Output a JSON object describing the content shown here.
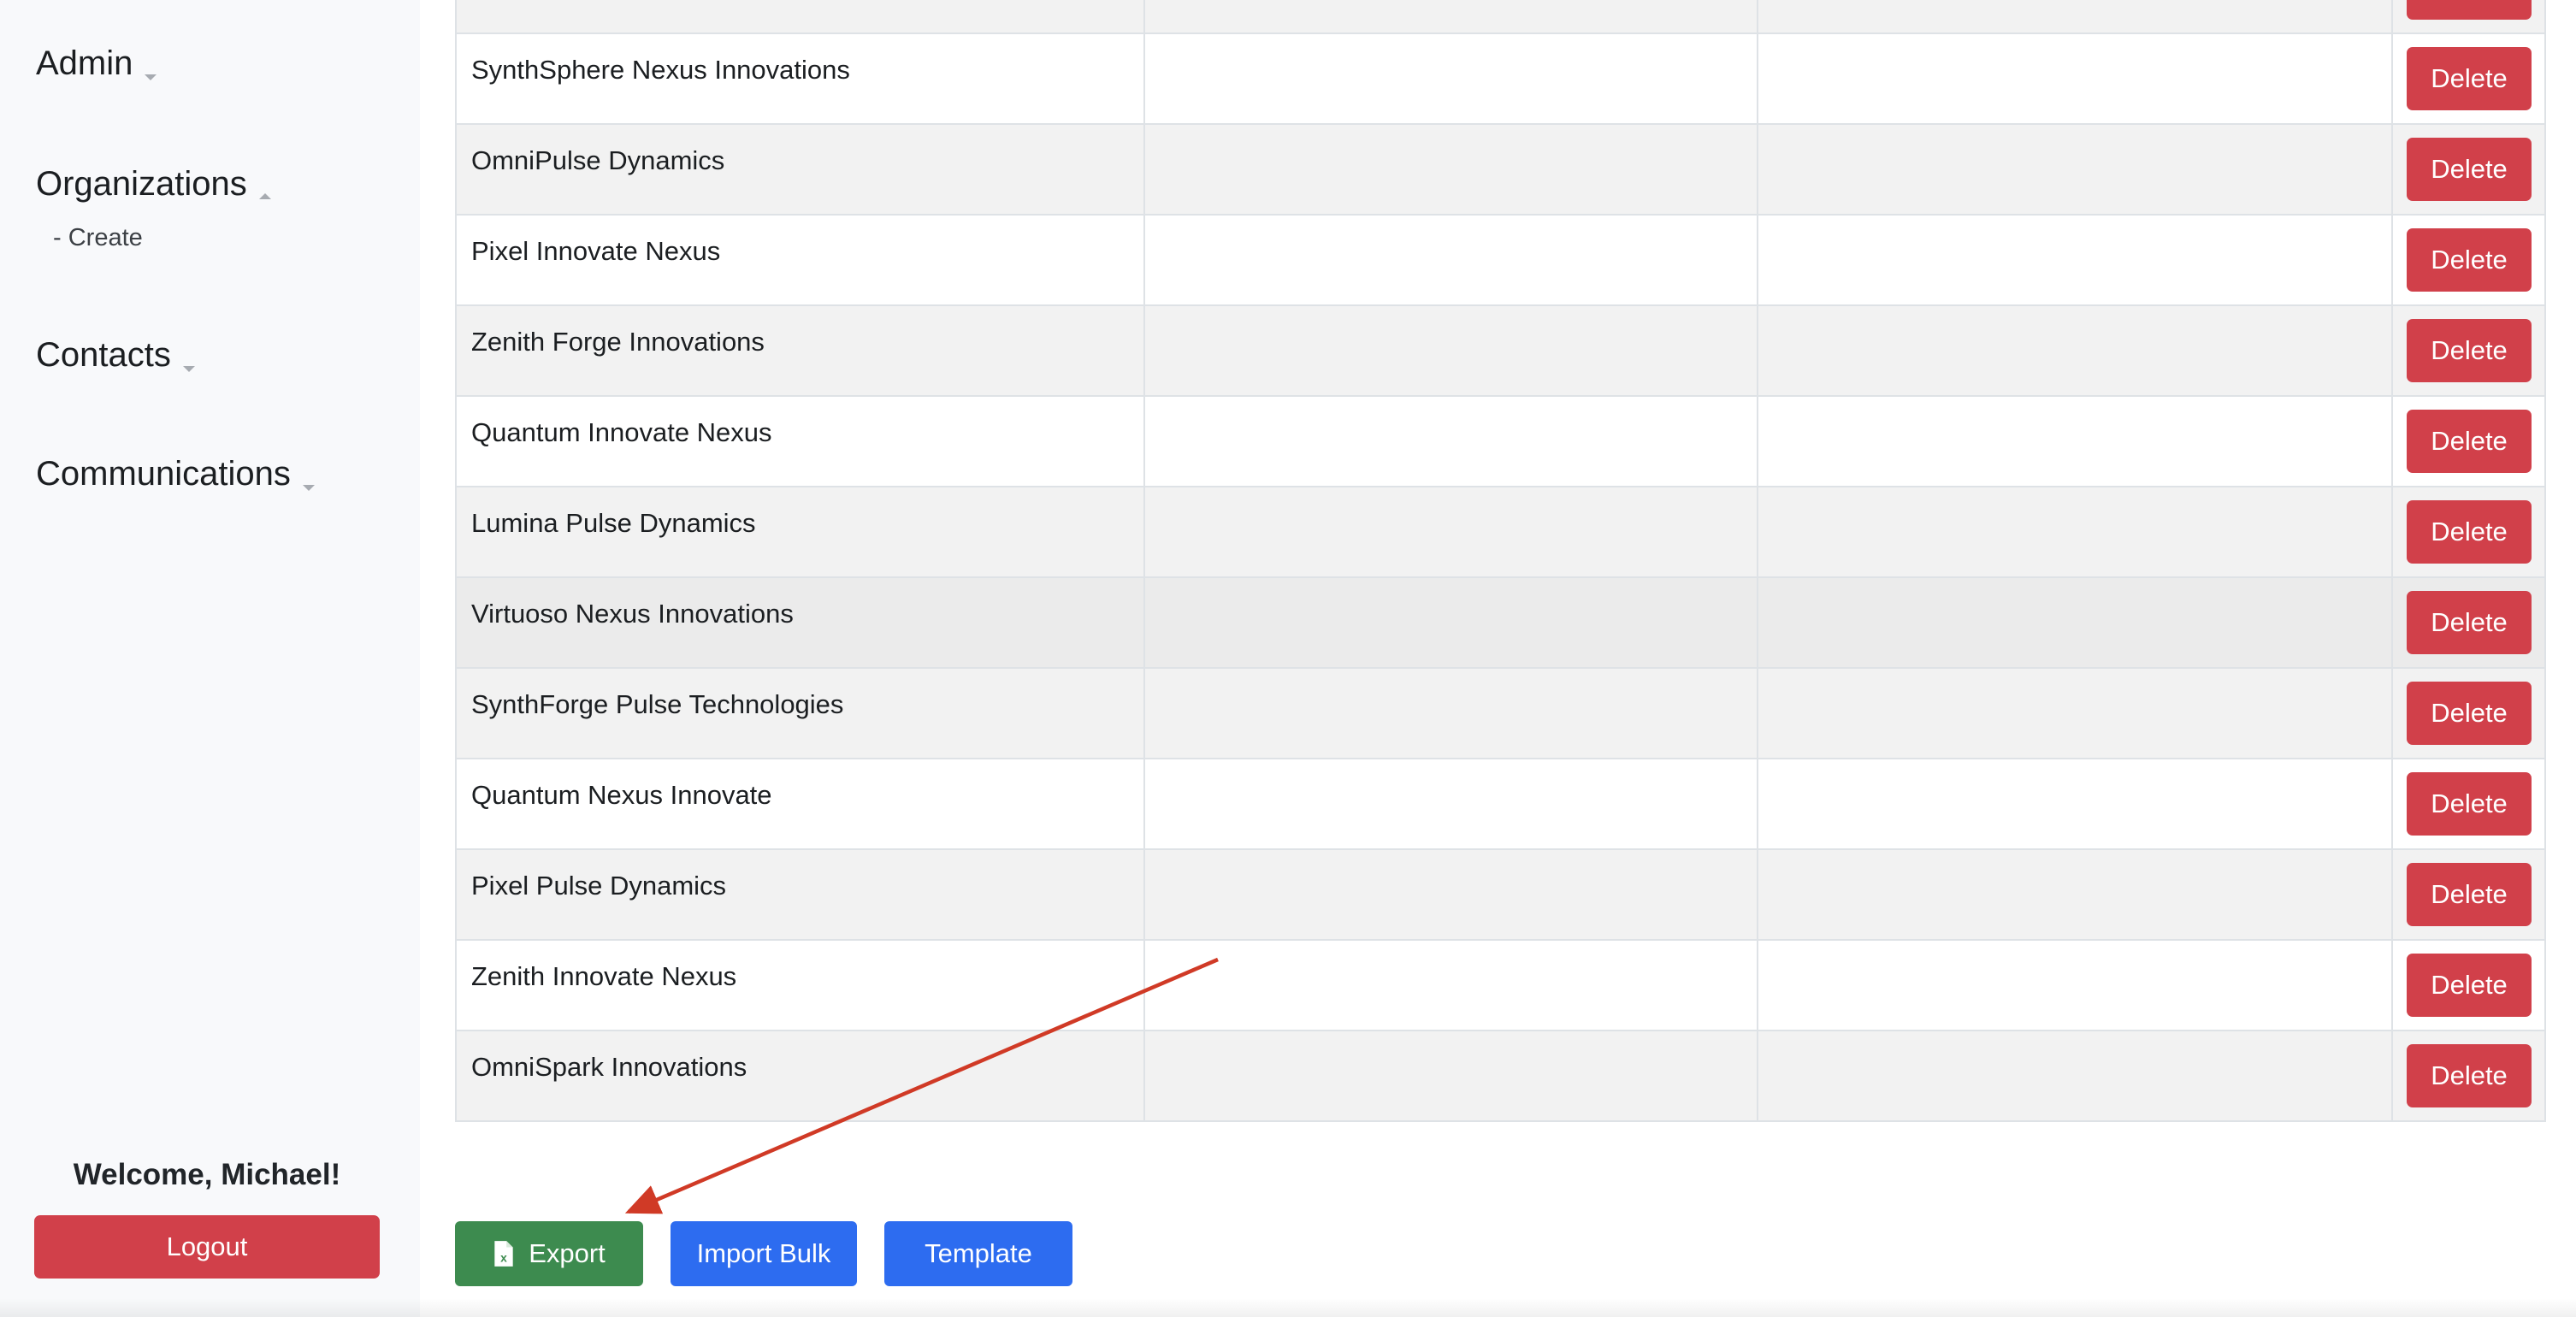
{
  "sidebar": {
    "sections": [
      {
        "label": "Admin",
        "caret": "down"
      },
      {
        "label": "Organizations",
        "caret": "up"
      },
      {
        "label": "Contacts",
        "caret": "down"
      },
      {
        "label": "Communications",
        "caret": "down"
      }
    ],
    "org_create_label": "- Create",
    "welcome_text": "Welcome, Michael!",
    "logout_label": "Logout"
  },
  "table": {
    "rows": [
      {
        "name": "",
        "delete_label": "Delete"
      },
      {
        "name": "SynthSphere Nexus Innovations",
        "delete_label": "Delete"
      },
      {
        "name": "OmniPulse Dynamics",
        "delete_label": "Delete"
      },
      {
        "name": "Pixel Innovate Nexus",
        "delete_label": "Delete"
      },
      {
        "name": "Zenith Forge Innovations",
        "delete_label": "Delete"
      },
      {
        "name": "Quantum Innovate Nexus",
        "delete_label": "Delete"
      },
      {
        "name": "Lumina Pulse Dynamics",
        "delete_label": "Delete"
      },
      {
        "name": "Virtuoso Nexus Innovations",
        "delete_label": "Delete"
      },
      {
        "name": "SynthForge Pulse Technologies",
        "delete_label": "Delete"
      },
      {
        "name": "Quantum Nexus Innovate",
        "delete_label": "Delete"
      },
      {
        "name": "Pixel Pulse Dynamics",
        "delete_label": "Delete"
      },
      {
        "name": "Zenith Innovate Nexus",
        "delete_label": "Delete"
      },
      {
        "name": "OmniSpark Innovations",
        "delete_label": "Delete"
      }
    ]
  },
  "actions": {
    "export_label": "Export",
    "export_icon": "excel-file-icon",
    "import_label": "Import Bulk",
    "template_label": "Template"
  },
  "colors": {
    "danger": "#d1404a",
    "success": "#3d8b4f",
    "primary": "#2d6cf0",
    "annotation_arrow": "#d03a26"
  }
}
